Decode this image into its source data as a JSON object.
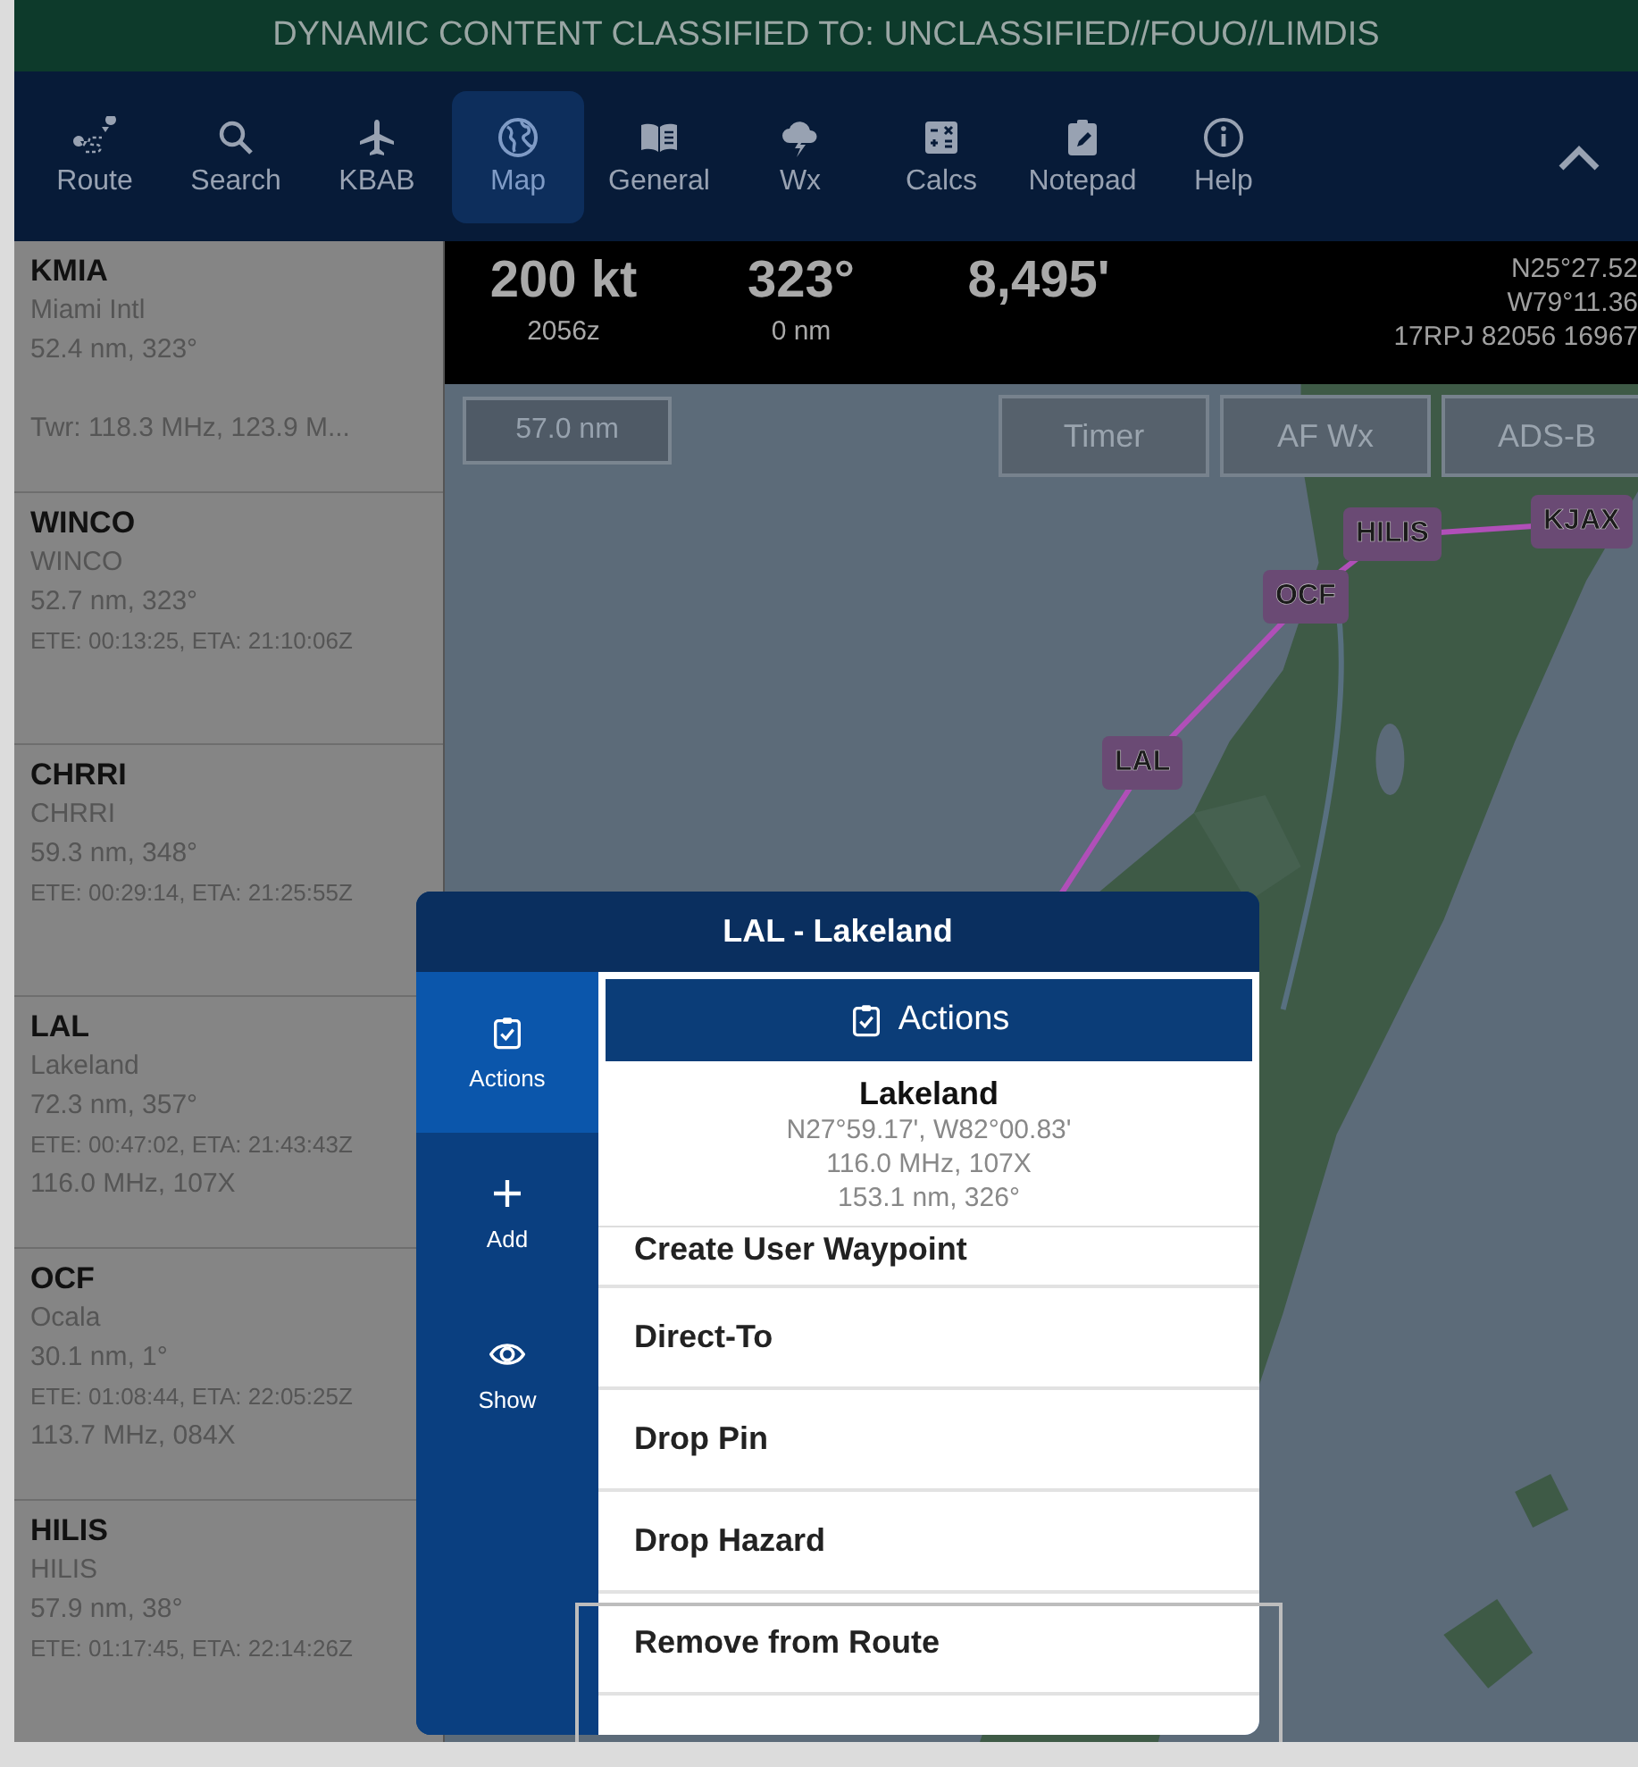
{
  "banner": {
    "text": "DYNAMIC CONTENT CLASSIFIED TO: UNCLASSIFIED//FOUO//LIMDIS"
  },
  "toolbar": {
    "items": [
      {
        "label": "Route",
        "selected": false
      },
      {
        "label": "Search",
        "selected": false
      },
      {
        "label": "KBAB",
        "selected": false
      },
      {
        "label": "Map",
        "selected": true
      },
      {
        "label": "General",
        "selected": false
      },
      {
        "label": "Wx",
        "selected": false
      },
      {
        "label": "Calcs",
        "selected": false
      },
      {
        "label": "Notepad",
        "selected": false
      },
      {
        "label": "Help",
        "selected": false
      }
    ]
  },
  "sidebar": {
    "waypoints": [
      {
        "ident": "KMIA",
        "name": "Miami Intl",
        "lines": [
          {
            "kind": "distance",
            "text": "52.4 nm, 323°"
          },
          {
            "kind": "comm",
            "text": "Twr: 118.3 MHz, 123.9 M..."
          }
        ]
      },
      {
        "ident": "WINCO",
        "name": "WINCO",
        "lines": [
          {
            "kind": "distance",
            "text": "52.7 nm, 323°"
          },
          {
            "kind": "timing",
            "text": "ETE: 00:13:25, ETA: 21:10:06Z"
          }
        ]
      },
      {
        "ident": "CHRRI",
        "name": "CHRRI",
        "lines": [
          {
            "kind": "distance",
            "text": "59.3 nm, 348°"
          },
          {
            "kind": "timing",
            "text": "ETE: 00:29:14, ETA: 21:25:55Z"
          }
        ]
      },
      {
        "ident": "LAL",
        "name": "Lakeland",
        "lines": [
          {
            "kind": "distance",
            "text": "72.3 nm, 357°"
          },
          {
            "kind": "timing",
            "text": "ETE: 00:47:02, ETA: 21:43:43Z"
          },
          {
            "kind": "freq",
            "text": "116.0 MHz, 107X"
          }
        ]
      },
      {
        "ident": "OCF",
        "name": "Ocala",
        "lines": [
          {
            "kind": "distance",
            "text": "30.1 nm, 1°"
          },
          {
            "kind": "timing",
            "text": "ETE: 01:08:44, ETA: 22:05:25Z"
          },
          {
            "kind": "freq",
            "text": "113.7 MHz, 084X"
          }
        ]
      },
      {
        "ident": "HILIS",
        "name": "HILIS",
        "lines": [
          {
            "kind": "distance",
            "text": "57.9 nm, 38°"
          },
          {
            "kind": "timing",
            "text": "ETE: 01:17:45, ETA: 22:14:26Z"
          }
        ]
      }
    ]
  },
  "info_bar": {
    "readouts": [
      {
        "value": "200 kt",
        "sub": "2056z"
      },
      {
        "value": "323°",
        "sub": "0 nm"
      },
      {
        "value": "8,495'"
      }
    ],
    "position": [
      "N25°27.52",
      "W79°11.36",
      "17RPJ 82056 16967"
    ]
  },
  "map": {
    "scale": "57.0 nm",
    "buttons": [
      "Timer",
      "AF Wx",
      "ADS-B"
    ],
    "route": [
      "LAL",
      "OCF",
      "HILIS",
      "KJAX"
    ]
  },
  "dialog": {
    "title": "LAL - Lakeland",
    "tabs": [
      {
        "label": "Actions",
        "selected": true
      },
      {
        "label": "Add",
        "selected": false
      },
      {
        "label": "Show",
        "selected": false
      }
    ],
    "section": "Actions",
    "place": "Lakeland",
    "details": [
      "N27°59.17', W82°00.83'",
      "116.0 MHz, 107X",
      "153.1 nm, 326°"
    ],
    "actions": [
      "Create User Waypoint",
      "Direct-To",
      "Drop Pin",
      "Drop Hazard",
      "Remove from Route"
    ]
  }
}
